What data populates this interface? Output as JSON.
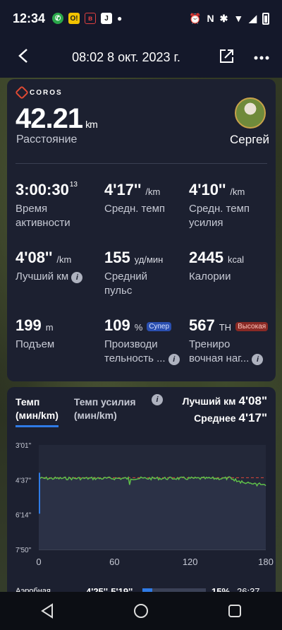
{
  "status": {
    "time": "12:34",
    "apps": [
      "whatsapp-icon",
      "ok-icon",
      "app-red-icon",
      "app-j-icon"
    ]
  },
  "header": {
    "title": "08:02 8 окт. 2023 г.",
    "back_icon": "back-icon",
    "share_icon": "share-icon",
    "more_icon": "more-icon"
  },
  "summary": {
    "brand": "COROS",
    "distance_value": "42.21",
    "distance_unit": "km",
    "distance_label": "Расстояние",
    "user_name": "Сергей"
  },
  "stats": [
    {
      "value": "3:00:30",
      "sup": "13",
      "unit": "",
      "label1": "Время",
      "label2": "активности⁠"
    },
    {
      "value": "4'17''",
      "unit": "/km",
      "label1": "Средн. темп",
      "label2": ""
    },
    {
      "value": "4'10''",
      "unit": "/km",
      "label1": "Средн. темп",
      "label2": "усилия⁠"
    },
    {
      "value": "4'08''",
      "unit": "/km",
      "label1": "Лучший км",
      "label2": ""
    },
    {
      "value": "155",
      "unit": "уд/мин",
      "label1": "Средний",
      "label2": "пульс"
    },
    {
      "value": "2445",
      "unit": "kcal",
      "label1": "Калории",
      "label2": ""
    },
    {
      "value": "199",
      "unit": "m",
      "label1": "Подъем",
      "label2": ""
    },
    {
      "value": "109",
      "unit": "%",
      "badge": "Супер",
      "label1": "Производи",
      "label2": "тельность ..."
    },
    {
      "value": "567",
      "unit": "TH",
      "badge": "Высокая",
      "label1": "Трениро",
      "label2": "вочная наг..."
    }
  ],
  "pace_tabs": {
    "tab1": "Темп",
    "tab1_unit": "(мин/km)",
    "tab2": "Темп усилия",
    "tab2_unit": "(мин/km)",
    "best_label": "Лучший км",
    "best_value": "4'08\"",
    "avg_label": "Среднее",
    "avg_value": "4'17\""
  },
  "chart_data": {
    "type": "line",
    "y_ticks": [
      "3'01\"",
      "4'37\"",
      "6'14\"",
      "7'50\""
    ],
    "x_ticks": [
      "0",
      "60",
      "120",
      "180"
    ],
    "xlim": [
      0,
      180
    ],
    "series_color": "#5fbf4a",
    "avg_line_color": "#e0453a",
    "avg_value": "4'17\""
  },
  "zone": {
    "name": "Аэробная",
    "range": "4'25''-5'19''",
    "percent": "15%",
    "time": "26:37",
    "fill_fraction": 0.15
  }
}
